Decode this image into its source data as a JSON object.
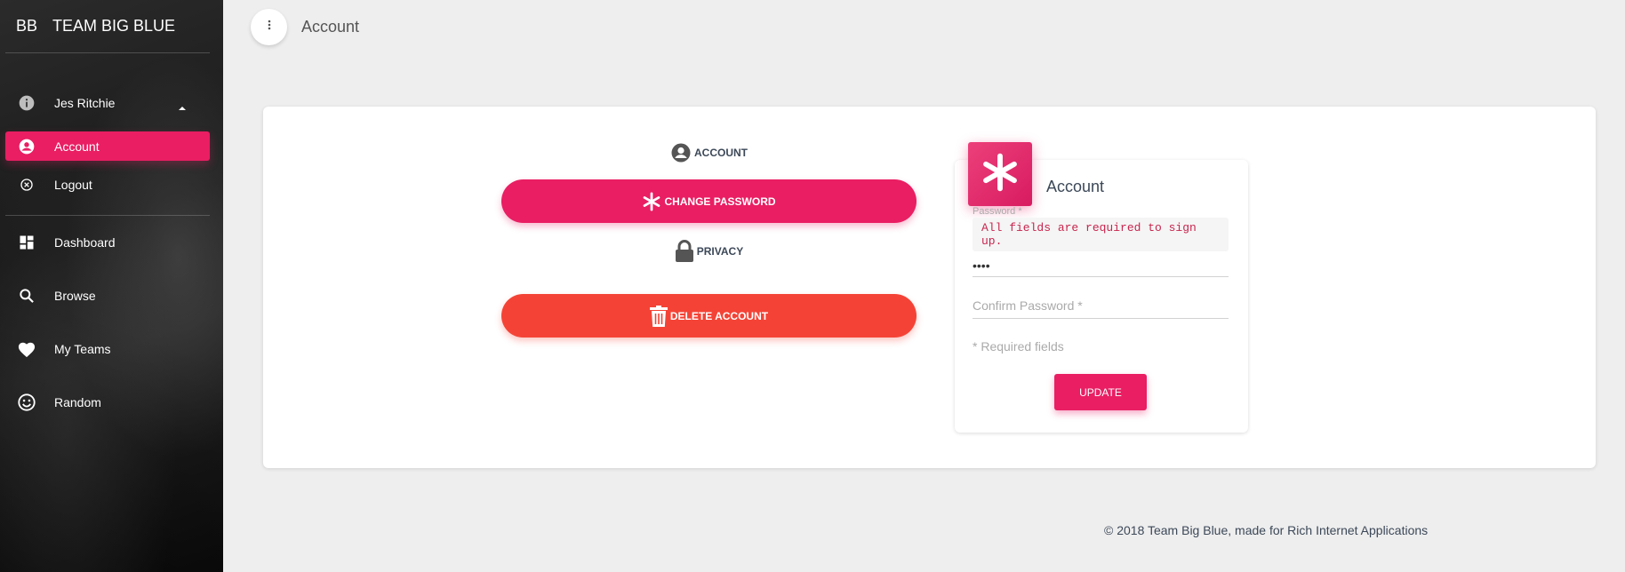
{
  "sidebar": {
    "brand_mini": "BB",
    "brand_name": "TEAM BIG BLUE",
    "user_name": "Jes Ritchie",
    "user_icon": "info-icon",
    "user_items": [
      {
        "label": "Account",
        "icon": "account-circle-icon",
        "active": true
      },
      {
        "label": "Logout",
        "icon": "cancel-circle-icon",
        "active": false
      }
    ],
    "nav_items": [
      {
        "label": "Dashboard",
        "icon": "dashboard-icon"
      },
      {
        "label": "Browse",
        "icon": "search-icon"
      },
      {
        "label": "My Teams",
        "icon": "heart-icon"
      },
      {
        "label": "Random",
        "icon": "smiley-icon"
      }
    ]
  },
  "topbar": {
    "menu_icon": "more-vert-icon",
    "title": "Account"
  },
  "left_panel": {
    "account_label": "ACCOUNT",
    "change_password_label": "CHANGE PASSWORD",
    "privacy_label": "PRIVACY",
    "delete_account_label": "DELETE ACCOUNT"
  },
  "form_card": {
    "badge_icon": "asterisk-icon",
    "title": "Account",
    "password_label": "Password *",
    "error_message": "All fields are required to sign up.",
    "password_value": "••••",
    "confirm_placeholder": "Confirm Password *",
    "required_note": "* Required fields",
    "update_label": "UPDATE"
  },
  "footer": {
    "text": "© 2018 Team Big Blue, made for Rich Internet Applications"
  },
  "colors": {
    "accent": "#e91e63",
    "danger": "#f44336",
    "error_text": "#c7254e",
    "background": "#eeeeee"
  }
}
